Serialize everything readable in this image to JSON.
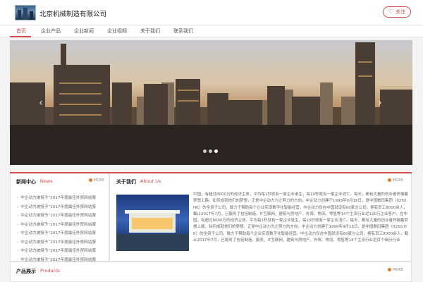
{
  "header": {
    "company_name": "北京机械制造有限公司",
    "follow_label": "关注",
    "follow_icon": "♡"
  },
  "nav": {
    "items": [
      {
        "label": "首页",
        "active": true
      },
      {
        "label": "企业产品"
      },
      {
        "label": "企业新闻"
      },
      {
        "label": "企业视频"
      },
      {
        "label": "关于我们"
      },
      {
        "label": "联系我们"
      }
    ]
  },
  "banner": {
    "prev_icon": "‹",
    "next_icon": "›",
    "slide_count": 3,
    "active_slide": 2
  },
  "news": {
    "title_cn": "新闻中心",
    "title_en": "News",
    "more_label": "MORE",
    "items": [
      "中企动力被授予“2017年度最佳外贸网站服",
      "中企动力被授予“2017年度最佳外贸网站服",
      "中企动力被授予“2017年度最佳外贸网站服",
      "中企动力被授予“2017年度最佳外贸网站服",
      "中企动力被授予“2017年度最佳外贸网站服",
      "中企动力被授予“2017年度最佳外贸网站服",
      "中企动力被授予“2017年度最佳外贸网站服",
      "中企动力被授予“2017年度最佳外贸网站服"
    ]
  },
  "about": {
    "title_cn": "关于我们",
    "title_en": "About Us",
    "more_label": "MORE",
    "text": "中国，有超过8000万的经济主体，平均每1秒就有一家企业诞生，每10秒就有一家企业消亡。每天，都有大量的创业者怀揣着梦想上路，如何成就他们的梦想，正是中企动力为之努力的方向。中企动力创建于1999年9月16日，是中国数码集团（0250.HK）的全资子公司，致力于帮助每个企业实现数字化智能经营。中企动力仅在中国就设有60家分公司，拥有员工8000余人，截止2017年7月，已服务了包括制造、IT互联网、建筑与房地产、外贸、物流、零售等14个主流行业近120万企业客户。在中国，有超过8000万的经济主体，平均每1秒就有一家企业诞生，每10秒就有一家企业消亡。每天，都有大量的创业者怀揣着梦想上路，如何成就他们的梦想，正是中企动力为之努力的方向。中企动力创建于1999年9月16日，是中国数码集团（0250.HK）的全资子公司，致力于帮助每个企业实现数字化智能经营。中企动力仅在中国就设有60家分公司，拥有员工8000余人，截止2017年7月，已服务了包括制造、服务、IT互联网、建筑与房地产、外贸、物流、零售等14个主流行业近百个细分行业"
  },
  "products": {
    "title_cn": "产品展示",
    "title_en": "Products",
    "more_label": "MORE"
  },
  "colors": {
    "accent": "#d14b4b",
    "more_dot": "#e07a2e"
  }
}
